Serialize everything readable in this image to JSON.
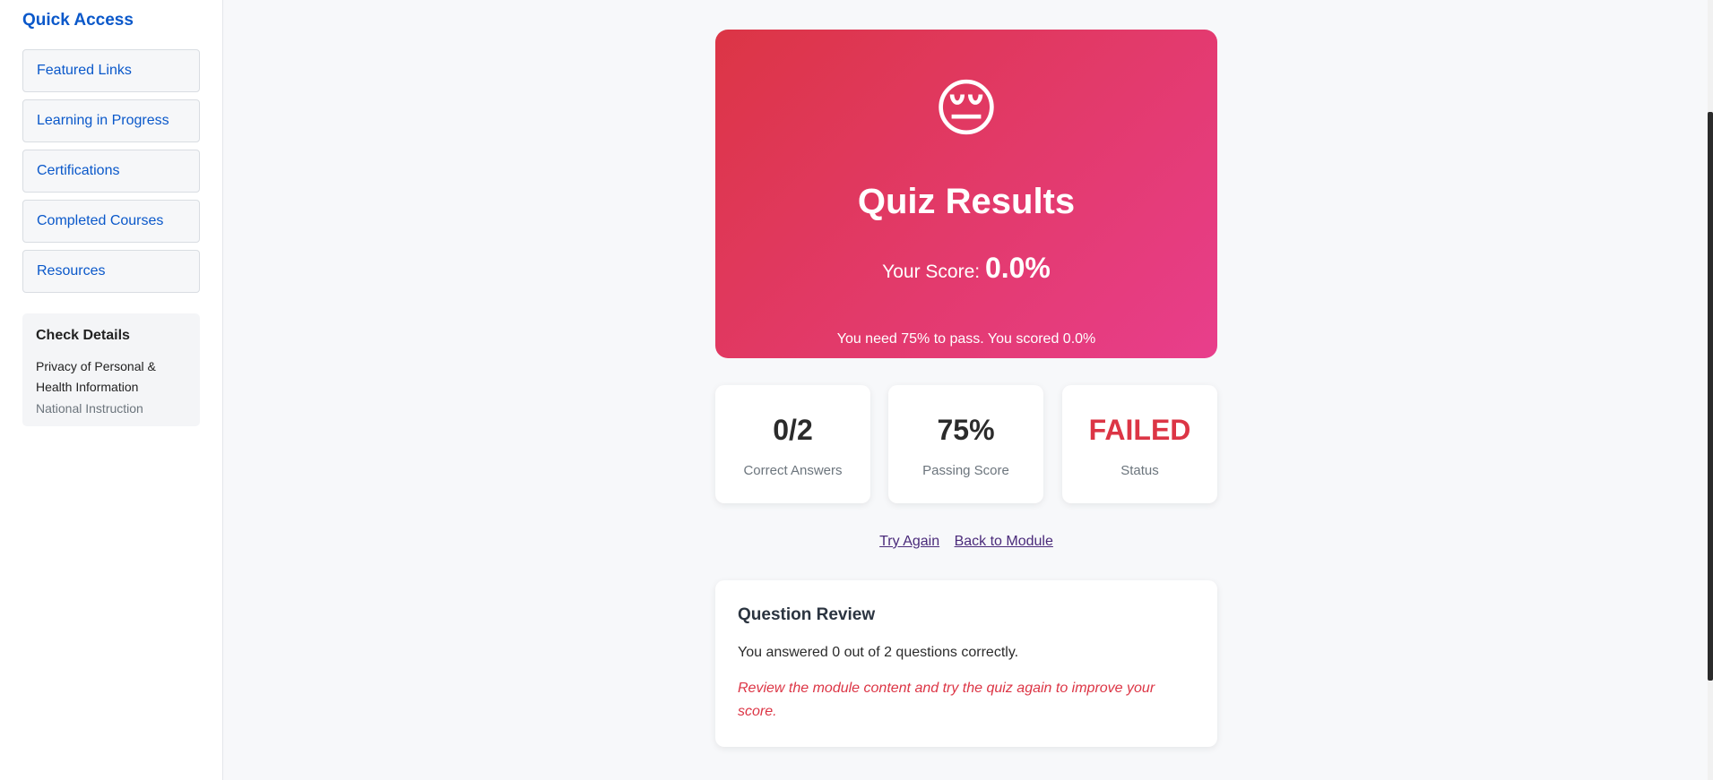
{
  "sidebar": {
    "title": "Quick Access",
    "items": [
      {
        "label": "Featured Links"
      },
      {
        "label": "Learning in Progress"
      },
      {
        "label": "Certifications"
      },
      {
        "label": "Completed Courses"
      },
      {
        "label": "Resources"
      }
    ],
    "check_details": {
      "title": "Check Details",
      "course_name": "Privacy of Personal & Health Information",
      "course_type": "National Instruction"
    }
  },
  "hero": {
    "emoji": "😔",
    "title": "Quiz Results",
    "score_label": "Your Score:",
    "score_value": "0.0%",
    "note": "You need 75% to pass. You scored 0.0%",
    "gradient_start": "#dc3545",
    "gradient_end": "#e83e8c"
  },
  "stats": [
    {
      "value": "0/2",
      "label": "Correct Answers"
    },
    {
      "value": "75%",
      "label": "Passing Score"
    },
    {
      "value": "FAILED",
      "label": "Status",
      "color": "#dc3545"
    }
  ],
  "actions": {
    "try_again": "Try Again",
    "back_to_module": "Back to Module"
  },
  "review": {
    "title": "Question Review",
    "summary": "You answered 0 out of 2 questions correctly.",
    "hint": "Review the module content and try the quiz again to improve your score."
  },
  "colors": {
    "accent": "#0a58ca",
    "danger": "#dc3545"
  }
}
